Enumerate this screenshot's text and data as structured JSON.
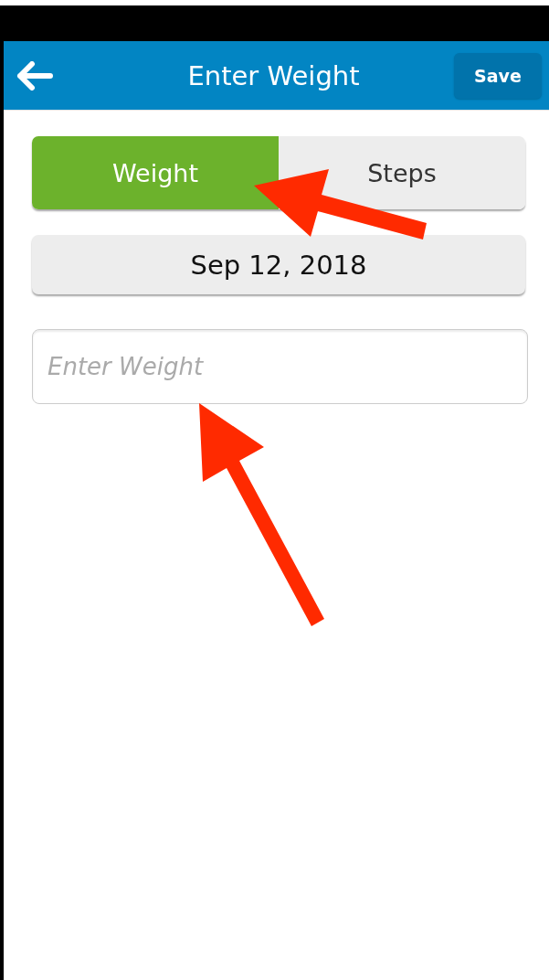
{
  "header": {
    "title": "Enter Weight",
    "save_button": "Save"
  },
  "tabs": [
    {
      "label": "Weight",
      "selected": true
    },
    {
      "label": "Steps",
      "selected": false
    }
  ],
  "date_button": "Sep 12, 2018",
  "weight_field": {
    "placeholder": "Enter Weight"
  }
}
